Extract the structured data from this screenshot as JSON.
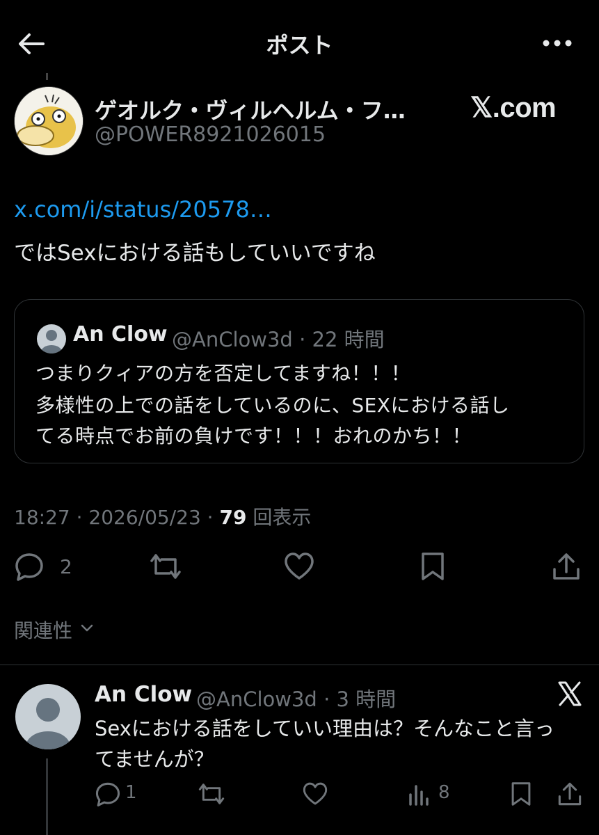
{
  "header": {
    "title": "ポスト",
    "back_icon": "arrow-left-icon",
    "more_icon": "more-horizontal-icon"
  },
  "author": {
    "name": "ゲオルク・ヴィルヘルム・フ…",
    "handle": "@POWER8921026015",
    "badge": "𝕏.com"
  },
  "post": {
    "link": "x.com/i/status/20578…",
    "text": "ではSexにおける話もしていいですね"
  },
  "quote": {
    "name": "An Clow",
    "handle_time": "@AnClow3d · 22 時間",
    "lines": [
      "つまりクィアの方を否定してますね！！！",
      "多様性の上での話をしているのに、SEXにおける話し",
      "てる時点でお前の負けです！！！おれのかち！！"
    ]
  },
  "meta": {
    "time": "18:27 · 2026/05/23 · ",
    "views": "79",
    "views_label": " 回表示"
  },
  "actions": {
    "reply_count": "2"
  },
  "relevance": {
    "label": "関連性"
  },
  "reply": {
    "name": "An Clow",
    "handle_time": "@AnClow3d · 3 時間",
    "lines": [
      "Sexにおける話をしていい理由は？そんなこと言っ",
      "てませんが？"
    ],
    "reply_count": "1",
    "views_count": "8"
  },
  "colors": {
    "background": "#000000",
    "text": "#e7e9ea",
    "muted": "#71767b",
    "link": "#1d9bf0",
    "border": "#2f3336"
  }
}
